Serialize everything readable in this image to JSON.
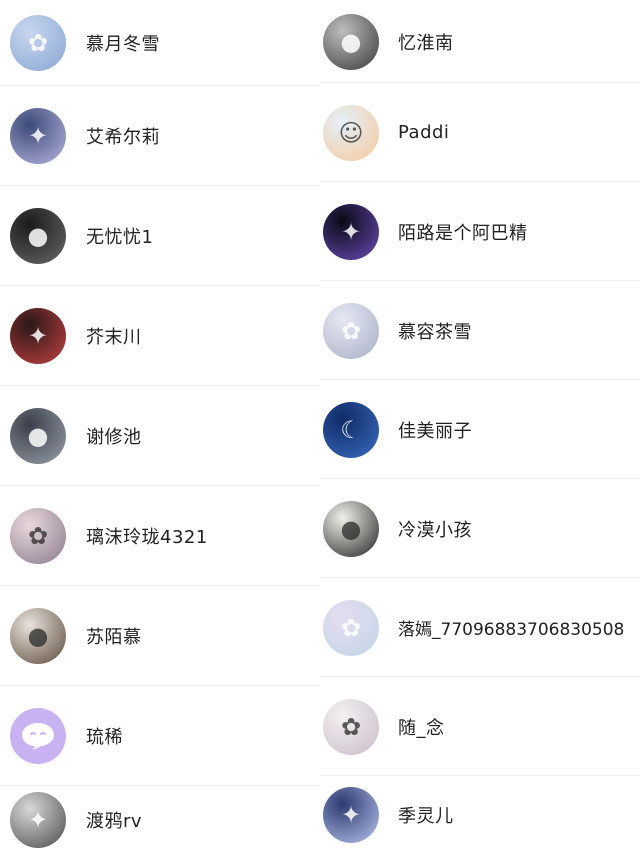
{
  "users": {
    "left": [
      {
        "name": "慕月冬雪",
        "icon": "anime-girl-blue-avatar-icon",
        "bg": "#c6d6ee",
        "bg2": "#8aa6d4"
      },
      {
        "name": "艾希尔莉",
        "icon": "anime-girl-silver-avatar-icon",
        "bg": "#3c4a78",
        "bg2": "#b7b6e0"
      },
      {
        "name": "无忧忧1",
        "icon": "dark-portrait-avatar-icon",
        "bg": "#1a1a1a",
        "bg2": "#6a6a6a"
      },
      {
        "name": "芥末川",
        "icon": "anime-boy-red-avatar-icon",
        "bg": "#2a1818",
        "bg2": "#c44040"
      },
      {
        "name": "谢修池",
        "icon": "selfie-dark-avatar-icon",
        "bg": "#3a3f4a",
        "bg2": "#9aa0a8"
      },
      {
        "name": "璃沫玲珑4321",
        "icon": "anime-girl-flowers-avatar-icon",
        "bg": "#e8d8dc",
        "bg2": "#8a7a8c"
      },
      {
        "name": "苏陌慕",
        "icon": "girl-portrait-avatar-icon",
        "bg": "#e9e3dc",
        "bg2": "#5c4a3c"
      },
      {
        "name": "琉稀",
        "icon": "chat-bubble-avatar-icon",
        "bg": "#c9b2f2",
        "bg2": "#c9b2f2"
      },
      {
        "name": "渡鸦rv",
        "icon": "anime-boy-gray-avatar-icon",
        "bg": "#d8d8d8",
        "bg2": "#4a4a4a"
      }
    ],
    "right": [
      {
        "name": "忆淮南",
        "icon": "mirror-selfie-avatar-icon",
        "bg": "#bdbdbd",
        "bg2": "#3a3a3a"
      },
      {
        "name": "Paddi",
        "icon": "cartoon-face-avatar-icon",
        "bg": "#e4f0fa",
        "bg2": "#f6c89a"
      },
      {
        "name": "陌路是个阿巴精",
        "icon": "dark-glow-avatar-icon",
        "bg": "#0a0a14",
        "bg2": "#6a4ab8"
      },
      {
        "name": "慕容茶雪",
        "icon": "anime-girl-white-avatar-icon",
        "bg": "#e6e8f2",
        "bg2": "#a8aec6"
      },
      {
        "name": "佳美丽子",
        "icon": "night-sky-avatar-icon",
        "bg": "#0f2a66",
        "bg2": "#3a6cc0"
      },
      {
        "name": "冷漠小孩",
        "icon": "boy-portrait-avatar-icon",
        "bg": "#f2f0ea",
        "bg2": "#222222"
      },
      {
        "name": "落嫣_77096883706830508",
        "icon": "anime-girl-pastel-avatar-icon",
        "bg": "#e6ddf0",
        "bg2": "#bfd6e6"
      },
      {
        "name": "随_念",
        "icon": "anime-girl-light-avatar-icon",
        "bg": "#f4f0f2",
        "bg2": "#c8bcc8"
      },
      {
        "name": "季灵儿",
        "icon": "anime-girl-stars-avatar-icon",
        "bg": "#2c3a70",
        "bg2": "#b8c4ee"
      }
    ]
  }
}
